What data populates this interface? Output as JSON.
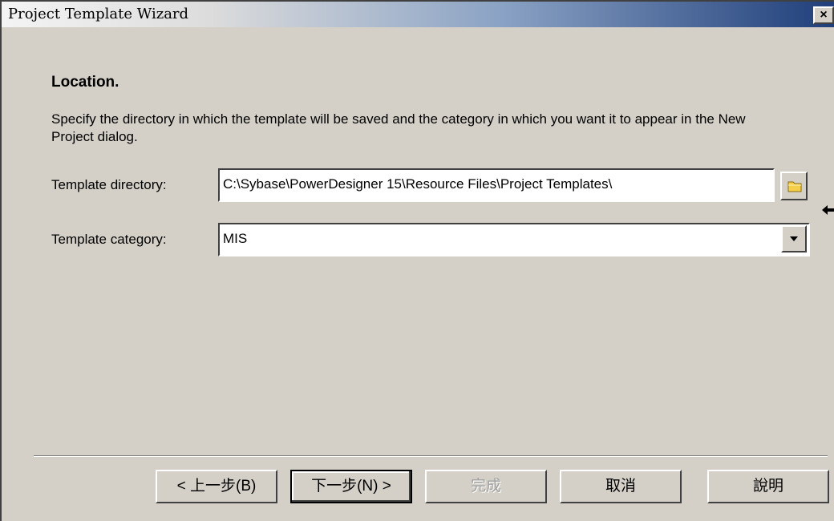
{
  "window": {
    "title": "Project Template Wizard",
    "close_label": "×"
  },
  "page": {
    "heading": "Location.",
    "description": "Specify the directory in which the template will be saved and the category in which you want it to appear in the New Project dialog."
  },
  "form": {
    "directory_label": "Template directory:",
    "directory_value": "C:\\Sybase\\PowerDesigner 15\\Resource Files\\Project Templates\\",
    "category_label": "Template category:",
    "category_value": "MIS"
  },
  "buttons": {
    "back": "< 上一步(B)",
    "next": "下一步(N) >",
    "finish": "完成",
    "cancel": "取消",
    "help": "說明"
  },
  "icons": {
    "browse": "folder-icon",
    "dropdown": "chevron-down-icon",
    "close": "close-icon"
  },
  "colors": {
    "dialog_bg": "#d4d0c8",
    "titlebar_end": "#1f3e7a",
    "disabled_text": "#a0a0a0"
  }
}
